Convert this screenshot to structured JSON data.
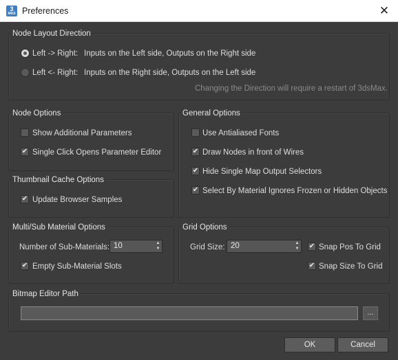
{
  "window": {
    "title": "Preferences",
    "close_glyph": "✕",
    "icon_text": "3",
    "icon_subtext": "MAX"
  },
  "node_layout": {
    "title": "Node Layout Direction",
    "options": [
      {
        "key": "Left -> Right:",
        "desc": "Inputs on the Left side, Outputs on the Right side",
        "selected": true
      },
      {
        "key": "Left <- Right:",
        "desc": "Inputs on the Right side, Outputs on the Left side",
        "selected": false
      }
    ],
    "hint": "Changing the Direction will require a restart of 3dsMax."
  },
  "node_options": {
    "title": "Node Options",
    "items": [
      {
        "label": "Show Additional Parameters",
        "checked": false
      },
      {
        "label": "Single Click Opens Parameter Editor",
        "checked": true
      }
    ]
  },
  "general_options": {
    "title": "General Options",
    "items": [
      {
        "label": "Use Antialiased Fonts",
        "checked": false
      },
      {
        "label": "Draw Nodes in front of Wires",
        "checked": true
      },
      {
        "label": "Hide Single Map Output Selectors",
        "checked": true
      },
      {
        "label": "Select By Material Ignores Frozen or Hidden Objects",
        "checked": true
      }
    ]
  },
  "thumbnail_cache": {
    "title": "Thumbnail Cache Options",
    "items": [
      {
        "label": "Update Browser Samples",
        "checked": true
      }
    ]
  },
  "multi_sub": {
    "title": "Multi/Sub Material Options",
    "count_label": "Number of Sub-Materials:",
    "count_value": "10",
    "empty_slots": {
      "label": "Empty Sub-Material Slots",
      "checked": true
    }
  },
  "grid": {
    "title": "Grid Options",
    "size_label": "Grid Size:",
    "size_value": "20",
    "snap_pos": {
      "label": "Snap Pos To Grid",
      "checked": true
    },
    "snap_size": {
      "label": "Snap Size To Grid",
      "checked": true
    }
  },
  "bitmap_editor": {
    "title": "Bitmap Editor Path",
    "path_value": "",
    "browse_label": "..."
  },
  "buttons": {
    "ok": "OK",
    "cancel": "Cancel"
  },
  "glyphs": {
    "check": "✔",
    "spin_up": "▲",
    "spin_down": "▼"
  }
}
